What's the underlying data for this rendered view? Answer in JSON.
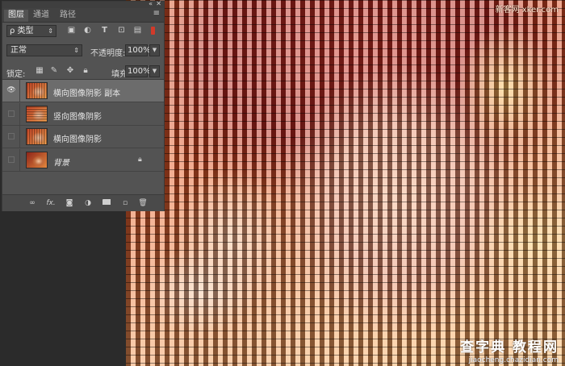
{
  "panel": {
    "tabs": [
      {
        "label": "图层",
        "active": true
      },
      {
        "label": "通道",
        "active": false
      },
      {
        "label": "路径",
        "active": false
      }
    ],
    "filter": {
      "label": "ρ 类型",
      "icons": [
        "pixel-filter-icon",
        "adjustment-filter-icon",
        "type-filter-icon",
        "shape-filter-icon",
        "smart-object-filter-icon"
      ]
    },
    "blend": {
      "mode": "正常",
      "opacity_label": "不透明度:",
      "opacity": "100%"
    },
    "lock": {
      "label": "锁定:",
      "fill_label": "填充:",
      "fill": "100%"
    },
    "layers": [
      {
        "name": "横向图像阴影 副本",
        "visible": true,
        "selected": true,
        "italic": false
      },
      {
        "name": "竖向图像阴影",
        "visible": false,
        "selected": false,
        "italic": false
      },
      {
        "name": "横向图像阴影",
        "visible": false,
        "selected": false,
        "italic": false
      },
      {
        "name": "背景",
        "visible": false,
        "selected": false,
        "italic": true,
        "locked": true
      }
    ],
    "footer_icons": [
      "link-layers-icon",
      "fx-icon",
      "mask-icon",
      "adjustment-icon",
      "group-icon",
      "new-layer-icon",
      "trash-icon"
    ],
    "fx_label": "fx."
  },
  "watermarks": {
    "top": "新客网 xker.com",
    "bottom_line1": "查字典 教程网",
    "bottom_line2": "jiaocheng.chazidian.com"
  },
  "colors": {
    "panel_bg": "#535353",
    "selected_layer": "#6c6c6c",
    "filter_toggle": "#d23a2a"
  }
}
